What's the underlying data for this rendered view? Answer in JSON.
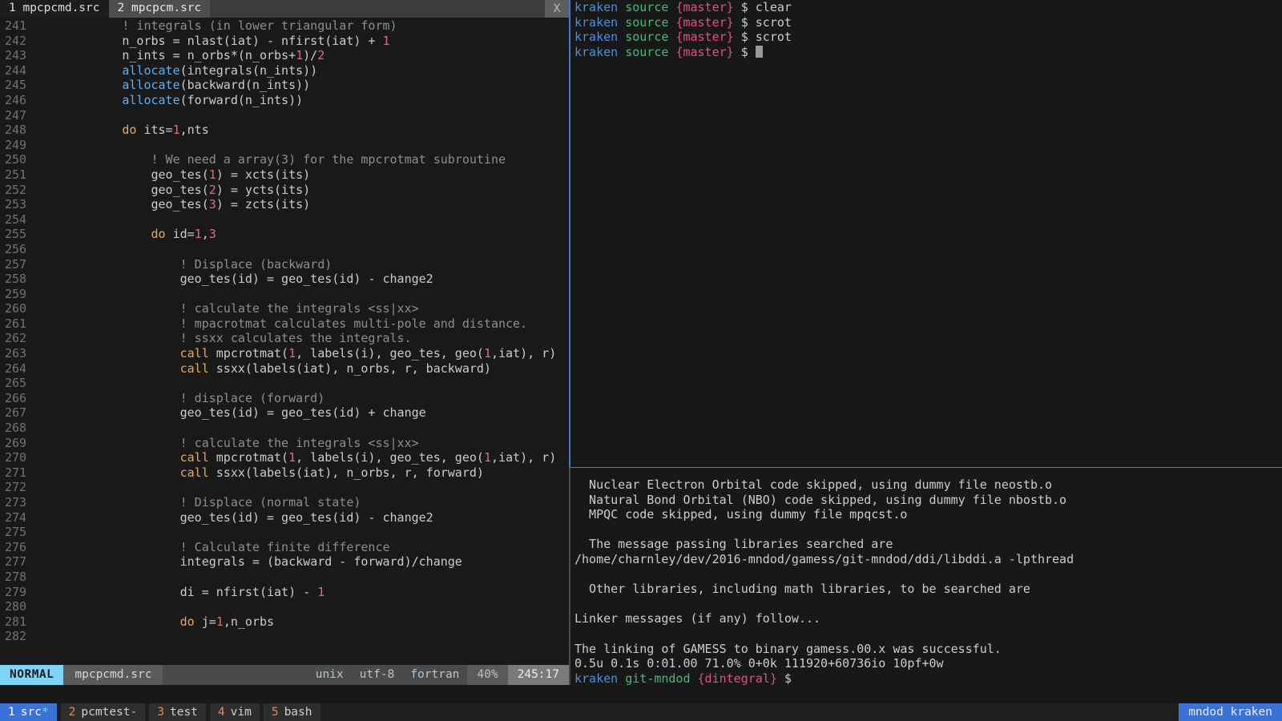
{
  "editor": {
    "tabs": [
      {
        "number": "1",
        "name": "mpcpcmd.src",
        "active": false
      },
      {
        "number": "2",
        "name": "mpcpcm.src",
        "active": true
      }
    ],
    "close_label": "X",
    "lines": [
      {
        "n": "241",
        "seg": [
          {
            "t": "            ! integrals (in lower triangular form)",
            "c": "cmt"
          }
        ]
      },
      {
        "n": "242",
        "seg": [
          {
            "t": "            n_orbs = nlast(iat) - nfirst(iat) + ",
            "c": "ctext"
          },
          {
            "t": "1",
            "c": "num"
          }
        ]
      },
      {
        "n": "243",
        "seg": [
          {
            "t": "            n_ints = n_orbs*(n_orbs+",
            "c": "ctext"
          },
          {
            "t": "1",
            "c": "num"
          },
          {
            "t": ")/",
            "c": "ctext"
          },
          {
            "t": "2",
            "c": "num"
          }
        ]
      },
      {
        "n": "244",
        "seg": [
          {
            "t": "            ",
            "c": "ctext"
          },
          {
            "t": "allocate",
            "c": "kw"
          },
          {
            "t": "(integrals(n_ints))",
            "c": "ctext"
          }
        ]
      },
      {
        "n": "245",
        "seg": [
          {
            "t": "            ",
            "c": "ctext"
          },
          {
            "t": "allocate",
            "c": "kw"
          },
          {
            "t": "(backward(n_ints))",
            "c": "ctext"
          }
        ]
      },
      {
        "n": "246",
        "seg": [
          {
            "t": "            ",
            "c": "ctext"
          },
          {
            "t": "allocate",
            "c": "kw"
          },
          {
            "t": "(forward(n_ints))",
            "c": "ctext"
          }
        ]
      },
      {
        "n": "247",
        "seg": []
      },
      {
        "n": "248",
        "seg": [
          {
            "t": "            ",
            "c": "ctext"
          },
          {
            "t": "do",
            "c": "fn"
          },
          {
            "t": " its=",
            "c": "ctext"
          },
          {
            "t": "1",
            "c": "num"
          },
          {
            "t": ",nts",
            "c": "ctext"
          }
        ]
      },
      {
        "n": "249",
        "seg": []
      },
      {
        "n": "250",
        "seg": [
          {
            "t": "                ! We need a array(3) for the mpcrotmat subroutine",
            "c": "cmt"
          }
        ]
      },
      {
        "n": "251",
        "seg": [
          {
            "t": "                geo_tes(",
            "c": "ctext"
          },
          {
            "t": "1",
            "c": "num"
          },
          {
            "t": ") = xcts(its)",
            "c": "ctext"
          }
        ]
      },
      {
        "n": "252",
        "seg": [
          {
            "t": "                geo_tes(",
            "c": "ctext"
          },
          {
            "t": "2",
            "c": "num"
          },
          {
            "t": ") = ycts(its)",
            "c": "ctext"
          }
        ]
      },
      {
        "n": "253",
        "seg": [
          {
            "t": "                geo_tes(",
            "c": "ctext"
          },
          {
            "t": "3",
            "c": "num"
          },
          {
            "t": ") = zcts(its)",
            "c": "ctext"
          }
        ]
      },
      {
        "n": "254",
        "seg": []
      },
      {
        "n": "255",
        "seg": [
          {
            "t": "                ",
            "c": "ctext"
          },
          {
            "t": "do",
            "c": "fn"
          },
          {
            "t": " id=",
            "c": "ctext"
          },
          {
            "t": "1",
            "c": "num"
          },
          {
            "t": ",",
            "c": "ctext"
          },
          {
            "t": "3",
            "c": "num"
          }
        ]
      },
      {
        "n": "256",
        "seg": []
      },
      {
        "n": "257",
        "seg": [
          {
            "t": "                    ! Displace (backward)",
            "c": "cmt"
          }
        ]
      },
      {
        "n": "258",
        "seg": [
          {
            "t": "                    geo_tes(id) = geo_tes(id) - change2",
            "c": "ctext"
          }
        ]
      },
      {
        "n": "259",
        "seg": []
      },
      {
        "n": "260",
        "seg": [
          {
            "t": "                    ! calculate the integrals <ss|xx>",
            "c": "cmt"
          }
        ]
      },
      {
        "n": "261",
        "seg": [
          {
            "t": "                    ! mpacrotmat calculates multi-pole and distance.",
            "c": "cmt"
          }
        ]
      },
      {
        "n": "262",
        "seg": [
          {
            "t": "                    ! ssxx calculates the integrals.",
            "c": "cmt"
          }
        ]
      },
      {
        "n": "263",
        "seg": [
          {
            "t": "                    ",
            "c": "ctext"
          },
          {
            "t": "call",
            "c": "fn"
          },
          {
            "t": " mpcrotmat(",
            "c": "ctext"
          },
          {
            "t": "1",
            "c": "num"
          },
          {
            "t": ", labels(i), geo_tes, geo(",
            "c": "ctext"
          },
          {
            "t": "1",
            "c": "num"
          },
          {
            "t": ",iat), r)",
            "c": "ctext"
          }
        ]
      },
      {
        "n": "264",
        "seg": [
          {
            "t": "                    ",
            "c": "ctext"
          },
          {
            "t": "call",
            "c": "fn"
          },
          {
            "t": " ssxx(labels(iat), n_orbs, r, backward)",
            "c": "ctext"
          }
        ]
      },
      {
        "n": "265",
        "seg": []
      },
      {
        "n": "266",
        "seg": [
          {
            "t": "                    ! displace (forward)",
            "c": "cmt"
          }
        ]
      },
      {
        "n": "267",
        "seg": [
          {
            "t": "                    geo_tes(id) = geo_tes(id) + change",
            "c": "ctext"
          }
        ]
      },
      {
        "n": "268",
        "seg": []
      },
      {
        "n": "269",
        "seg": [
          {
            "t": "                    ! calculate the integrals <ss|xx>",
            "c": "cmt"
          }
        ]
      },
      {
        "n": "270",
        "seg": [
          {
            "t": "                    ",
            "c": "ctext"
          },
          {
            "t": "call",
            "c": "fn"
          },
          {
            "t": " mpcrotmat(",
            "c": "ctext"
          },
          {
            "t": "1",
            "c": "num"
          },
          {
            "t": ", labels(i), geo_tes, geo(",
            "c": "ctext"
          },
          {
            "t": "1",
            "c": "num"
          },
          {
            "t": ",iat), r)",
            "c": "ctext"
          }
        ]
      },
      {
        "n": "271",
        "seg": [
          {
            "t": "                    ",
            "c": "ctext"
          },
          {
            "t": "call",
            "c": "fn"
          },
          {
            "t": " ssxx(labels(iat), n_orbs, r, forward)",
            "c": "ctext"
          }
        ]
      },
      {
        "n": "272",
        "seg": []
      },
      {
        "n": "273",
        "seg": [
          {
            "t": "                    ! Displace (normal state)",
            "c": "cmt"
          }
        ]
      },
      {
        "n": "274",
        "seg": [
          {
            "t": "                    geo_tes(id) = geo_tes(id) - change2",
            "c": "ctext"
          }
        ]
      },
      {
        "n": "275",
        "seg": []
      },
      {
        "n": "276",
        "seg": [
          {
            "t": "                    ! Calculate finite difference",
            "c": "cmt"
          }
        ]
      },
      {
        "n": "277",
        "seg": [
          {
            "t": "                    integrals = (backward - forward)/change",
            "c": "ctext"
          }
        ]
      },
      {
        "n": "278",
        "seg": []
      },
      {
        "n": "279",
        "seg": [
          {
            "t": "                    di = nfirst(iat) - ",
            "c": "ctext"
          },
          {
            "t": "1",
            "c": "num"
          }
        ]
      },
      {
        "n": "280",
        "seg": []
      },
      {
        "n": "281",
        "seg": [
          {
            "t": "                    ",
            "c": "ctext"
          },
          {
            "t": "do",
            "c": "fn"
          },
          {
            "t": " j=",
            "c": "ctext"
          },
          {
            "t": "1",
            "c": "num"
          },
          {
            "t": ",n_orbs",
            "c": "ctext"
          }
        ]
      },
      {
        "n": "282",
        "seg": []
      }
    ],
    "statusline": {
      "mode": "NORMAL",
      "filename": "mpcpcmd.src",
      "fileformat": "unix",
      "encoding": "utf-8",
      "filetype": "fortran",
      "percent": "40%",
      "position": "245:17"
    }
  },
  "terminal": {
    "top_pane": [
      {
        "host": "kraken",
        "repo": "source",
        "branch": "{master}",
        "prompt": "$",
        "cmd": "clear"
      },
      {
        "host": "kraken",
        "repo": "source",
        "branch": "{master}",
        "prompt": "$",
        "cmd": "scrot"
      },
      {
        "host": "kraken",
        "repo": "source",
        "branch": "{master}",
        "prompt": "$",
        "cmd": "scrot"
      },
      {
        "host": "kraken",
        "repo": "source",
        "branch": "{master}",
        "prompt": "$",
        "cmd": ""
      }
    ],
    "bottom_pane": {
      "output": [
        "  Nuclear Electron Orbital code skipped, using dummy file neostb.o",
        "  Natural Bond Orbital (NBO) code skipped, using dummy file nbostb.o",
        "  MPQC code skipped, using dummy file mpqcst.o",
        "",
        "  The message passing libraries searched are",
        "/home/charnley/dev/2016-mndod/gamess/git-mndod/ddi/libddi.a -lpthread",
        "",
        "  Other libraries, including math libraries, to be searched are",
        "",
        "Linker messages (if any) follow...",
        "",
        "The linking of GAMESS to binary gamess.00.x was successful.",
        "0.5u 0.1s 0:01.00 71.0% 0+0k 111920+60736io 10pf+0w"
      ],
      "prompt": {
        "host": "kraken",
        "repo": "git-mndod",
        "branch": "{dintegral}",
        "symbol": "$"
      }
    }
  },
  "tmux": {
    "windows": [
      {
        "number": "1",
        "title": "src",
        "flag": "*",
        "active": true
      },
      {
        "number": "2",
        "title": "pcmtest",
        "flag": "-",
        "active": false
      },
      {
        "number": "3",
        "title": "test",
        "flag": "",
        "active": false
      },
      {
        "number": "4",
        "title": "vim",
        "flag": "",
        "active": false
      },
      {
        "number": "5",
        "title": "bash",
        "flag": "",
        "active": false
      }
    ],
    "right_status": "mndod kraken"
  },
  "colors": {
    "accent_blue": "#3a72d8",
    "mode_cyan": "#7fd3f7",
    "comment_grey": "#8a8f94",
    "number_red": "#e06c75",
    "keyword_blue": "#61afef",
    "func_orange": "#e5a95c",
    "prompt_host": "#4a8fe0",
    "prompt_repo": "#45b97c",
    "prompt_branch": "#e0527a"
  }
}
